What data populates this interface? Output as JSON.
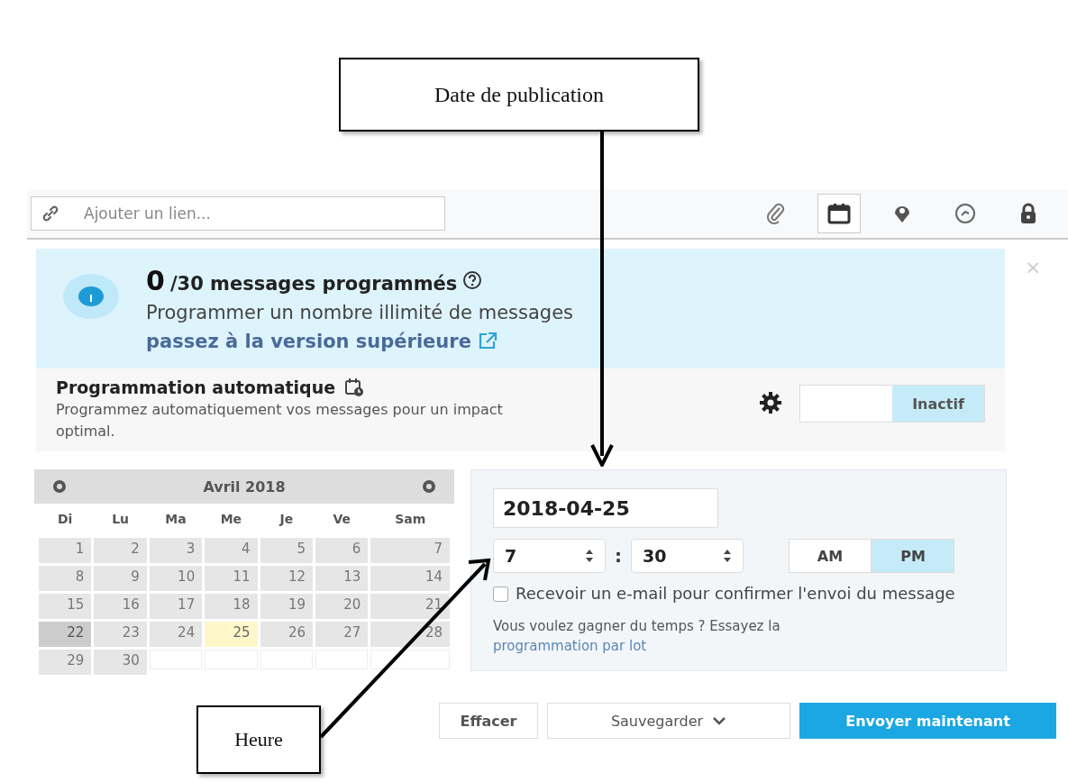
{
  "callouts": [
    {
      "label": "Date de publication",
      "kind": "date"
    },
    {
      "label": "Heure",
      "kind": "time"
    }
  ],
  "toolbar": {
    "link_placeholder": "Ajouter un lien...",
    "tools": [
      {
        "kind": "attachment",
        "selected": false
      },
      {
        "kind": "calendar",
        "selected": true
      },
      {
        "kind": "location",
        "selected": false
      },
      {
        "kind": "target",
        "selected": false
      },
      {
        "kind": "lock",
        "selected": false
      }
    ]
  },
  "banner": {
    "count": "0",
    "title": "/30 messages programmés",
    "text": "Programmer un nombre illimité de messages",
    "link": "passez à la version supérieure",
    "close": "×"
  },
  "auto_schedule": {
    "title": "Programmation automatique",
    "description": "Programmez automatiquement vos messages pour un impact optimal.",
    "toggle": {
      "label": "Inactif",
      "on": false
    }
  },
  "calendar": {
    "month": "Avril 2018",
    "weekdays": [
      "Di",
      "Lu",
      "Ma",
      "Me",
      "Je",
      "Ve",
      "Sam"
    ],
    "weeks": [
      [
        {
          "label": "1",
          "selected": false,
          "today": false
        },
        {
          "label": "2",
          "selected": false,
          "today": false
        },
        {
          "label": "3",
          "selected": false,
          "today": false
        },
        {
          "label": "4",
          "selected": false,
          "today": false
        },
        {
          "label": "5",
          "selected": false,
          "today": false
        },
        {
          "label": "6",
          "selected": false,
          "today": false
        },
        {
          "label": "7",
          "selected": false,
          "today": false
        }
      ],
      [
        {
          "label": "8",
          "selected": false,
          "today": false
        },
        {
          "label": "9",
          "selected": false,
          "today": false
        },
        {
          "label": "10",
          "selected": false,
          "today": false
        },
        {
          "label": "11",
          "selected": false,
          "today": false
        },
        {
          "label": "12",
          "selected": false,
          "today": false
        },
        {
          "label": "13",
          "selected": false,
          "today": false
        },
        {
          "label": "14",
          "selected": false,
          "today": false
        }
      ],
      [
        {
          "label": "15",
          "selected": false,
          "today": false
        },
        {
          "label": "16",
          "selected": false,
          "today": false
        },
        {
          "label": "17",
          "selected": false,
          "today": false
        },
        {
          "label": "18",
          "selected": false,
          "today": false
        },
        {
          "label": "19",
          "selected": false,
          "today": false
        },
        {
          "label": "20",
          "selected": false,
          "today": false
        },
        {
          "label": "21",
          "selected": false,
          "today": false
        }
      ],
      [
        {
          "label": "22",
          "selected": false,
          "today": true
        },
        {
          "label": "23",
          "selected": false,
          "today": false
        },
        {
          "label": "24",
          "selected": false,
          "today": false
        },
        {
          "label": "25",
          "selected": true,
          "today": false
        },
        {
          "label": "26",
          "selected": false,
          "today": false
        },
        {
          "label": "27",
          "selected": false,
          "today": false
        },
        {
          "label": "28",
          "selected": false,
          "today": false
        }
      ],
      [
        {
          "label": "29",
          "selected": false,
          "today": false
        },
        {
          "label": "30",
          "selected": false,
          "today": false
        }
      ]
    ]
  },
  "schedule": {
    "date": "2018-04-25",
    "hour": "7",
    "separator": ":",
    "minute": "30",
    "meridiem": [
      {
        "label": "AM",
        "selected": false
      },
      {
        "label": "PM",
        "selected": true
      }
    ],
    "email_confirm": {
      "label": "Recevoir un e-mail pour confirmer l'envoi du message",
      "checked": false
    },
    "hint": "Vous voulez gagner du temps ? Essayez la",
    "hint_link": "programmation par lot"
  },
  "buttons": [
    {
      "label": "Effacer",
      "kind": "plain"
    },
    {
      "label": "Sauvegarder",
      "kind": "dropdown"
    },
    {
      "label": "Envoyer maintenant",
      "kind": "primary"
    }
  ]
}
